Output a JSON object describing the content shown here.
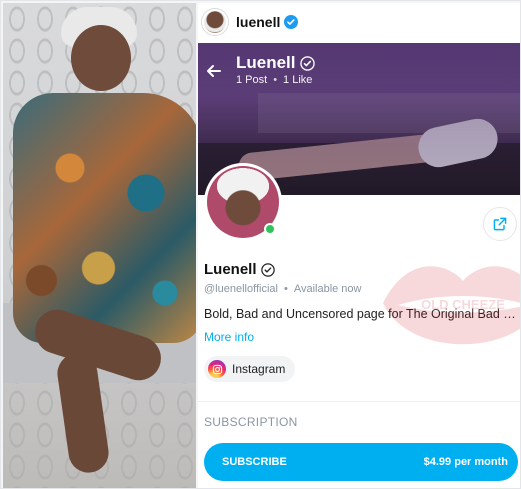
{
  "topbar": {
    "username": "luenell"
  },
  "cover": {
    "title": "Luenell",
    "posts": "1 Post",
    "separator": "•",
    "likes": "1 Like"
  },
  "profile": {
    "name": "Luenell",
    "handle": "@luenellofficial",
    "dot": "•",
    "status": "Available now",
    "bio": "Bold, Bad and Uncensored page for The Original Bad Bitch Luenell",
    "more_link": "More info",
    "social_chip": "Instagram"
  },
  "subscription": {
    "section_title": "SUBSCRIPTION",
    "button_label": "SUBSCRIBE",
    "price": "$4.99 per month"
  },
  "watermark": {
    "text": "OLD CHEEZE"
  },
  "colors": {
    "accent": "#00aff0",
    "online": "#32c25a",
    "muted": "#8a96a3"
  }
}
